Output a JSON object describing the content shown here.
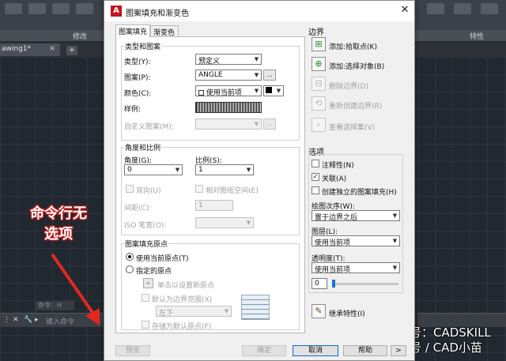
{
  "background": {
    "panel_modify": "修改",
    "panel_properties": "特性",
    "drawing_tab": "awing1*",
    "tab_close": "×",
    "tab_add": "+",
    "cmd_tag": "命令：H",
    "cmd_placeholder": "键入命令"
  },
  "annotation": {
    "line1": "命令行无",
    "line2": "选项"
  },
  "watermark": {
    "line1": "微信号：CADSKILL",
    "line2": "头条号 / CAD小苗"
  },
  "dialog": {
    "title": "图案填充和渐变色",
    "close": "✕",
    "tabs": [
      {
        "label": "图案填充",
        "active": true
      },
      {
        "label": "渐变色",
        "active": false
      }
    ],
    "type_pattern": {
      "title": "类型和图案",
      "type_label": "类型(Y):",
      "type_value": "预定义",
      "pattern_label": "图案(P):",
      "pattern_value": "ANGLE",
      "pattern_browse": "...",
      "color_label": "颜色(C):",
      "color_value": "使用当前项",
      "sample_label": "样例:",
      "custom_label": "自定义图案(M):",
      "custom_browse": "..."
    },
    "angle_scale": {
      "title": "角度和比例",
      "angle_label": "角度(G):",
      "angle_value": "0",
      "scale_label": "比例(S):",
      "scale_value": "1",
      "double_label": "双向(U)",
      "relative_label": "相对图纸空间(E)",
      "spacing_label": "间距(C):",
      "spacing_value": "1",
      "iso_label": "ISO 笔宽(O):"
    },
    "origin": {
      "title": "图案填充原点",
      "use_current": "使用当前原点(T)",
      "specified": "指定的原点",
      "click_set": "单击以设置新原点",
      "default_extent": "默认为边界范围(X)",
      "position_value": "左下",
      "store_default": "存储为默认原点(F)"
    },
    "boundary": {
      "title": "边界",
      "add_pick": "添加:拾取点(K)",
      "add_select": "添加:选择对象(B)",
      "remove": "删除边界(D)",
      "recreate": "重新创建边界(R)",
      "view": "查看选择集(V)"
    },
    "options": {
      "title": "选项",
      "annotative": "注释性(N)",
      "associative": "关联(A)",
      "separate": "创建独立的图案填充(H)",
      "draw_order_label": "绘图次序(W):",
      "draw_order_value": "置于边界之后",
      "layer_label": "图层(L):",
      "layer_value": "使用当前项",
      "transparency_label": "透明度(T):",
      "transparency_value": "使用当前项",
      "transparency_num": "0",
      "transparency_level": 0
    },
    "inherit": "继承特性(I)",
    "buttons": {
      "preview": "预览",
      "ok": "确定",
      "cancel": "取消",
      "help": "帮助"
    }
  }
}
